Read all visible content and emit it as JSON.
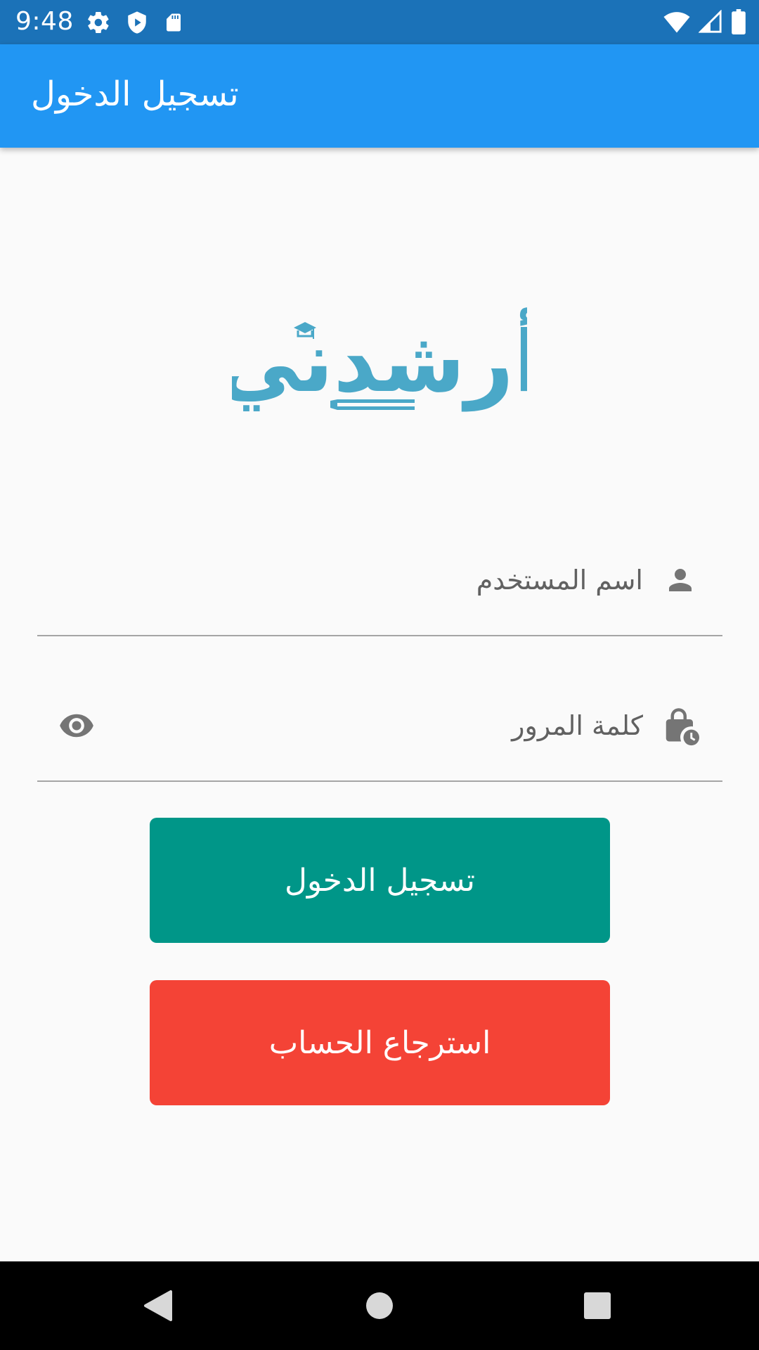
{
  "status_bar": {
    "time": "9:48",
    "left_icons": [
      "gear-icon",
      "shield-play-icon",
      "sd-card-icon"
    ],
    "right_icons": [
      "wifi-icon",
      "cell-signal-icon",
      "battery-icon"
    ]
  },
  "app_bar": {
    "title": "تسجيل الدخول",
    "color": "#2196f3"
  },
  "logo": {
    "text": "أرشدني",
    "color": "#4aa8c8",
    "icon": "graduation-cap-icon"
  },
  "form": {
    "username": {
      "placeholder": "اسم المستخدم",
      "value": "",
      "icon": "person-icon"
    },
    "password": {
      "placeholder": "كلمة المرور",
      "value": "",
      "icon": "lock-clock-icon",
      "toggle_icon": "eye-icon"
    }
  },
  "buttons": {
    "login": {
      "label": "تسجيل الدخول",
      "color": "#009688"
    },
    "recover": {
      "label": "استرجاع الحساب",
      "color": "#f44336"
    }
  },
  "nav_bar": {
    "buttons": [
      "back-icon",
      "home-icon",
      "recents-icon"
    ]
  }
}
